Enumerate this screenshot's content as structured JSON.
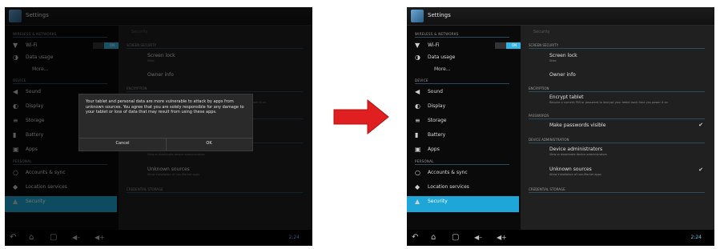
{
  "app": {
    "title": "Settings"
  },
  "sidebar": {
    "categories": [
      "WIRELESS & NETWORKS",
      "DEVICE",
      "PERSONAL"
    ],
    "items": [
      {
        "icon": "▼",
        "label": "Wi-Fi",
        "toggle": "ON"
      },
      {
        "icon": "◑",
        "label": "Data usage"
      },
      {
        "icon": "",
        "label": "More..."
      },
      {
        "icon": "◀",
        "label": "Sound"
      },
      {
        "icon": "◐",
        "label": "Display"
      },
      {
        "icon": "≡",
        "label": "Storage"
      },
      {
        "icon": "▮",
        "label": "Battery"
      },
      {
        "icon": "▣",
        "label": "Apps"
      },
      {
        "icon": "○",
        "label": "Accounts & sync"
      },
      {
        "icon": "◆",
        "label": "Location services"
      },
      {
        "icon": "▲",
        "label": "Security"
      }
    ]
  },
  "detail": {
    "header": "Security",
    "categories": [
      "SCREEN SECURITY",
      "ENCRYPTION",
      "PASSWORDS",
      "DEVICE ADMINISTRATION",
      "CREDENTIAL STORAGE"
    ],
    "rows": [
      {
        "title": "Screen lock",
        "sub": "Slide"
      },
      {
        "title": "Owner info",
        "sub": ""
      },
      {
        "title": "Encrypt tablet",
        "sub": "Require a numeric PIN or password to decrypt your tablet each time you power it on"
      },
      {
        "title": "Make passwords visible",
        "sub": ""
      },
      {
        "title": "Device administrators",
        "sub": "View or deactivate device administrators"
      },
      {
        "title": "Unknown sources",
        "sub": "Allow installation of non-Market apps"
      }
    ],
    "check": "✔"
  },
  "dialog": {
    "message": "Your tablet and personal data are more vulnerable to attack by apps from unknown sources. You agree that you are solely responsible for any damage to your tablet or loss of data that may result from using these apps.",
    "cancel": "Cancel",
    "ok": "OK"
  },
  "navbar": {
    "back": "↶",
    "home": "⌂",
    "recents": "▢",
    "vol_down": "◀–",
    "vol_up": "◀+",
    "status": "2:24"
  },
  "colors": {
    "accent": "#33b5e5",
    "selected": "#1ea6d8",
    "arrow": "#e02020"
  }
}
